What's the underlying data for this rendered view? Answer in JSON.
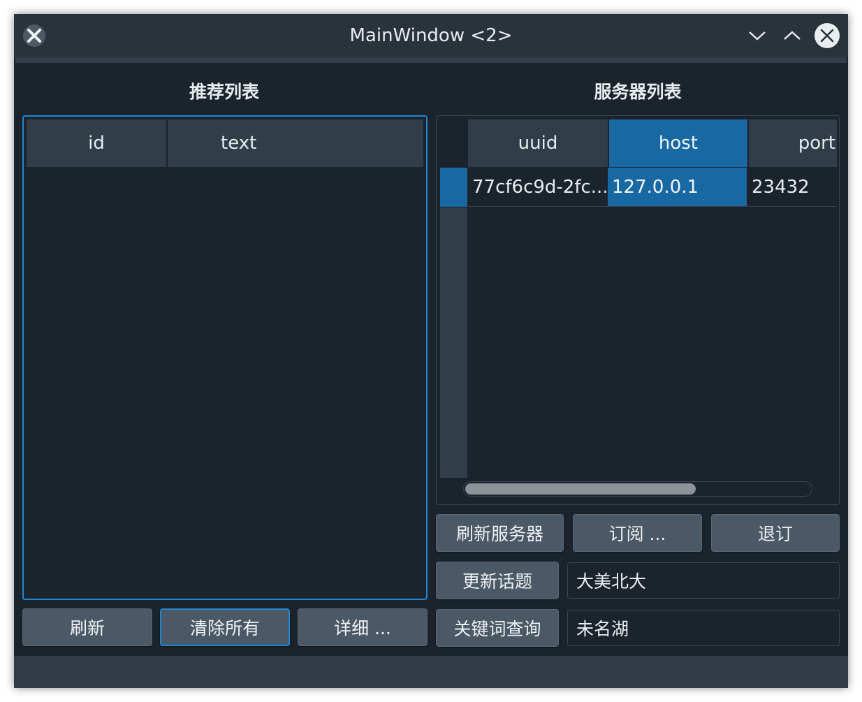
{
  "window": {
    "title": "MainWindow <2>"
  },
  "titlebar": {
    "app_icon": "x-app-icon",
    "buttons": [
      "chevron-down-icon",
      "chevron-up-icon",
      "close-icon"
    ]
  },
  "left": {
    "heading": "推荐列表",
    "columns": [
      "id",
      "text"
    ],
    "buttons": {
      "refresh": "刷新",
      "clear_all": "清除所有",
      "details": "详细 ..."
    }
  },
  "right": {
    "heading": "服务器列表",
    "columns": [
      "uuid",
      "host",
      "port"
    ],
    "rows": [
      {
        "uuid": "77cf6c9d-2fc...",
        "host": "127.0.0.1",
        "port": "23432"
      }
    ],
    "buttons": {
      "refresh_servers": "刷新服务器",
      "subscribe": "订阅 ...",
      "unsubscribe": "退订",
      "update_topic": "更新话题",
      "keyword_query": "关键词查询"
    },
    "fields": {
      "topic_value": "大美北大",
      "keyword_value": "未名湖"
    }
  },
  "colors": {
    "background": "#1b232d",
    "header": "#313d49",
    "selection": "#1868a3",
    "focus": "#2386d0",
    "button": "#4b5866"
  }
}
